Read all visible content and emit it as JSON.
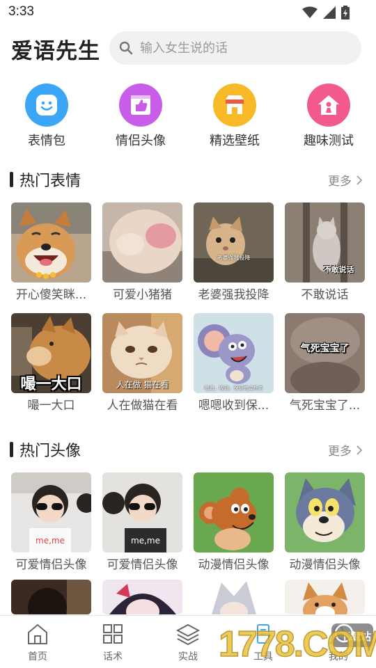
{
  "status": {
    "time": "3:33"
  },
  "header": {
    "title": "爱语先生",
    "search_placeholder": "输入女生说的话"
  },
  "categories": [
    {
      "label": "表情包",
      "icon": "smiley-icon",
      "color": "#3aa6f5"
    },
    {
      "label": "情侣头像",
      "icon": "thumbs-up-photo-icon",
      "color": "#c85ee8"
    },
    {
      "label": "精选壁纸",
      "icon": "shop-icon",
      "color": "#f7b928"
    },
    {
      "label": "趣味测试",
      "icon": "house-person-icon",
      "color": "#f25a8e"
    }
  ],
  "hot_stickers": {
    "title": "热门表情",
    "more": "更多",
    "items": [
      {
        "caption": "开心傻笑眯...",
        "overlay": ""
      },
      {
        "caption": "可爱小猪猪",
        "overlay": ""
      },
      {
        "caption": "老婆强我投降",
        "overlay": "老婆强我投降"
      },
      {
        "caption": "不敢说话",
        "overlay": "不敢说话"
      },
      {
        "caption": "嘬一大口",
        "overlay": "嘬一大口"
      },
      {
        "caption": "人在做猫在看",
        "overlay": "人在做 猫在看"
      },
      {
        "caption": "嗯嗯收到保...",
        "overlay": "嗯嗯，收到，保证完成任务"
      },
      {
        "caption": "气死宝宝了...",
        "overlay": "气死宝宝了"
      }
    ]
  },
  "hot_avatars": {
    "title": "热门头像",
    "more": "更多",
    "items": [
      {
        "caption": "可爱情侣头像"
      },
      {
        "caption": "可爱情侣头像"
      },
      {
        "caption": "动漫情侣头像"
      },
      {
        "caption": "动漫情侣头像"
      }
    ]
  },
  "bottom_nav": [
    {
      "label": "首页",
      "icon": "home-icon"
    },
    {
      "label": "话术",
      "icon": "grid-icon"
    },
    {
      "label": "实战",
      "icon": "layers-icon"
    },
    {
      "label": "工具",
      "icon": "tool-icon"
    },
    {
      "label": "我的",
      "icon": "profile-icon"
    }
  ],
  "watermark": {
    "text": "1778.COM",
    "badge": "下载站"
  }
}
